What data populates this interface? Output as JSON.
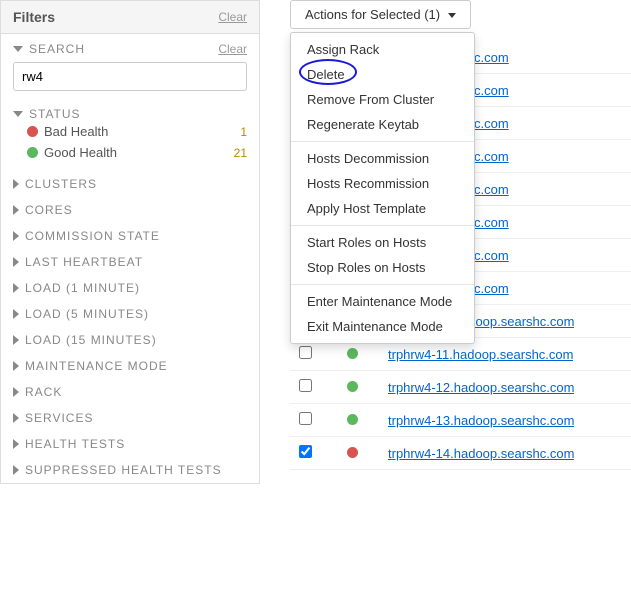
{
  "sidebar": {
    "title": "Filters",
    "clear": "Clear",
    "search": {
      "label": "SEARCH",
      "clear": "Clear",
      "value": "rw4"
    },
    "status": {
      "label": "STATUS",
      "items": [
        {
          "label": "Bad Health",
          "count": "1",
          "color": "red"
        },
        {
          "label": "Good Health",
          "count": "21",
          "color": "green"
        }
      ]
    },
    "collapsed": [
      "CLUSTERS",
      "CORES",
      "COMMISSION STATE",
      "LAST HEARTBEAT",
      "LOAD (1 MINUTE)",
      "LOAD (5 MINUTES)",
      "LOAD (15 MINUTES)",
      "MAINTENANCE MODE",
      "RACK",
      "SERVICES",
      "HEALTH TESTS",
      "SUPPRESSED HEALTH TESTS"
    ]
  },
  "actions": {
    "button": "Actions for Selected (1)",
    "menu": [
      "Assign Rack",
      "Delete",
      "Remove From Cluster",
      "Regenerate Keytab",
      "---",
      "Hosts Decommission",
      "Hosts Recommission",
      "Apply Host Template",
      "---",
      "Start Roles on Hosts",
      "Stop Roles on Hosts",
      "---",
      "Enter Maintenance Mode",
      "Exit Maintenance Mode"
    ],
    "highlighted": "Delete"
  },
  "hosts": [
    {
      "checked": false,
      "status": "green",
      "name": "hadoop.searshc.com"
    },
    {
      "checked": false,
      "status": "green",
      "name": "hadoop.searshc.com"
    },
    {
      "checked": false,
      "status": "green",
      "name": "hadoop.searshc.com"
    },
    {
      "checked": false,
      "status": "green",
      "name": "hadoop.searshc.com"
    },
    {
      "checked": false,
      "status": "green",
      "name": "hadoop.searshc.com"
    },
    {
      "checked": false,
      "status": "green",
      "name": "hadoop.searshc.com"
    },
    {
      "checked": false,
      "status": "green",
      "name": "hadoop.searshc.com"
    },
    {
      "checked": false,
      "status": "green",
      "name": "hadoop.searshc.com"
    },
    {
      "checked": false,
      "status": "green",
      "name": "trphrw4-10.hadoop.searshc.com"
    },
    {
      "checked": false,
      "status": "green",
      "name": "trphrw4-11.hadoop.searshc.com"
    },
    {
      "checked": false,
      "status": "green",
      "name": "trphrw4-12.hadoop.searshc.com"
    },
    {
      "checked": false,
      "status": "green",
      "name": "trphrw4-13.hadoop.searshc.com"
    },
    {
      "checked": true,
      "status": "red",
      "name": "trphrw4-14.hadoop.searshc.com"
    }
  ]
}
